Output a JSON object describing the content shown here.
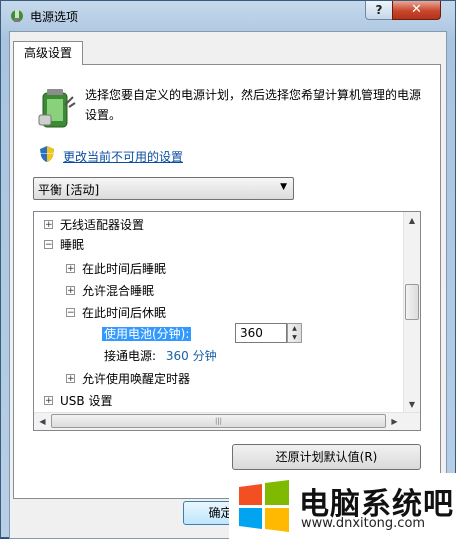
{
  "window": {
    "title": "电源选项",
    "help_glyph": "?",
    "close_glyph": "✕"
  },
  "tab": {
    "label": "高级设置"
  },
  "description": "选择您要自定义的电源计划，然后选择您希望计算机管理的电源设置。",
  "change_link": "更改当前不可用的设置",
  "plan_select": {
    "value": "平衡 [活动]"
  },
  "tree": {
    "items": [
      {
        "label": "无线适配器设置",
        "expander": "+"
      },
      {
        "label": "睡眠",
        "expander": "−"
      },
      {
        "label": "在此时间后睡眠",
        "expander": "+"
      },
      {
        "label": "允许混合睡眠",
        "expander": "+"
      },
      {
        "label": "在此时间后休眠",
        "expander": "−"
      },
      {
        "label": "允许使用唤醒定时器",
        "expander": "+"
      },
      {
        "label": "USB 设置",
        "expander": "+"
      }
    ],
    "battery_label": "使用电池(分钟):",
    "battery_value": "360",
    "plugged_label": "接通电源:",
    "plugged_value": "360 分钟"
  },
  "buttons": {
    "restore": "还原计划默认值(R)",
    "ok": "确定"
  },
  "watermark": {
    "title": "电脑系统吧",
    "url": "www.dnxitong.com"
  },
  "colors": {
    "titlebar": "#b7cfe7",
    "link": "#0a4ea0",
    "selection": "#3399ff",
    "close_button": "#c8462c"
  }
}
